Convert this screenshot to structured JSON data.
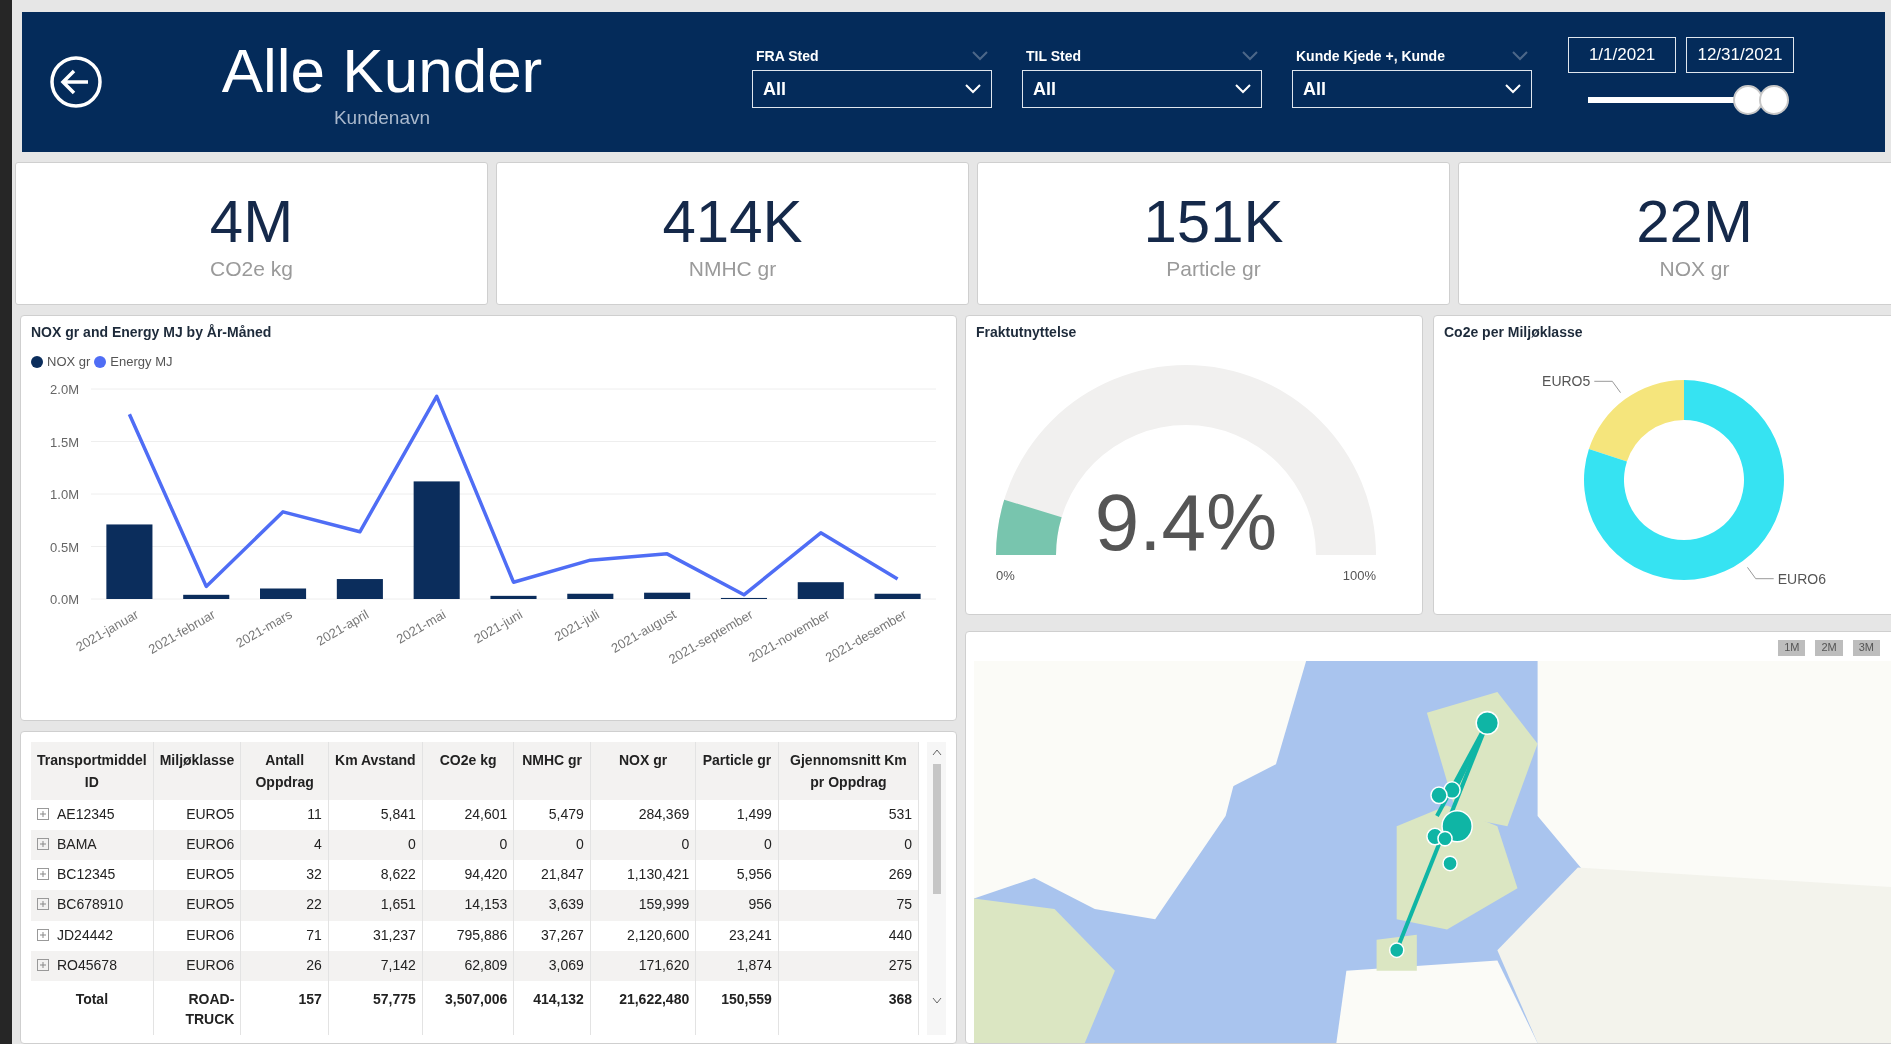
{
  "header": {
    "title": "Alle Kunder",
    "subtitle": "Kundenavn",
    "filters": [
      {
        "label": "FRA Sted",
        "value": "All"
      },
      {
        "label": "TIL Sted",
        "value": "All"
      },
      {
        "label": "Kunde Kjede +, Kunde",
        "value": "All"
      }
    ],
    "date_from": "1/1/2021",
    "date_to": "12/31/2021",
    "date_slider": {
      "thumbs": [
        {
          "level": 0.8
        },
        {
          "level": 0.93
        }
      ]
    }
  },
  "kpis": [
    {
      "value": "4M",
      "label": "CO2e kg"
    },
    {
      "value": "414K",
      "label": "NMHC gr"
    },
    {
      "value": "151K",
      "label": "Particle gr"
    },
    {
      "value": "22M",
      "label": "NOX gr"
    }
  ],
  "combo_chart": {
    "chart_data": {
      "type": "bar",
      "title": "NOX gr and Energy MJ by År-Måned",
      "categories": [
        "2021-januar",
        "2021-februar",
        "2021-mars",
        "2021-april",
        "2021-mai",
        "2021-juni",
        "2021-juli",
        "2021-august",
        "2021-september",
        "2021-november",
        "2021-desember"
      ],
      "series": [
        {
          "name": "NOX gr",
          "color": "#0b2d5c",
          "type": "bar",
          "values": [
            710000,
            40000,
            100000,
            190000,
            1120000,
            30000,
            50000,
            60000,
            10000,
            160000,
            50000
          ]
        },
        {
          "name": "Energy MJ",
          "color": "#4f6df5",
          "type": "line",
          "values": [
            1760000,
            120000,
            830000,
            640000,
            1930000,
            160000,
            370000,
            430000,
            40000,
            630000,
            190000
          ]
        }
      ],
      "ylim": [
        0,
        2000000
      ],
      "grid": true,
      "yticks": [
        {
          "value": 0,
          "label": "0.0M"
        },
        {
          "value": 500000,
          "label": "0.5M"
        },
        {
          "value": 1000000,
          "label": "1.0M"
        },
        {
          "value": 1500000,
          "label": "1.5M"
        },
        {
          "value": 2000000,
          "label": "2.0M"
        }
      ]
    }
  },
  "gauge": {
    "title": "Fraktutnyttelse",
    "level": 0.094,
    "reading": "9.4%",
    "min": "0%",
    "max": "100%"
  },
  "donut": {
    "title": "Co2e per Miljøklasse",
    "slices": [
      {
        "label": "EURO5",
        "color": "#f5e57c"
      },
      {
        "label": "EURO6",
        "color": "#36e3f2"
      }
    ]
  },
  "table": {
    "columns": [
      "Transportmiddel ID",
      "Miljøklasse",
      "Antall Oppdrag",
      "Km Avstand",
      "CO2e kg",
      "NMHC gr",
      "NOX gr",
      "Particle gr",
      "Gjennomsnitt Km pr Oppdrag"
    ],
    "rows": [
      [
        "AE12345",
        "EURO5",
        "11",
        "5,841",
        "24,601",
        "5,479",
        "284,369",
        "1,499",
        "531"
      ],
      [
        "BAMA",
        "EURO6",
        "4",
        "0",
        "0",
        "0",
        "0",
        "0",
        "0"
      ],
      [
        "BC12345",
        "EURO5",
        "32",
        "8,622",
        "94,420",
        "21,847",
        "1,130,421",
        "5,956",
        "269"
      ],
      [
        "BC678910",
        "EURO5",
        "22",
        "1,651",
        "14,153",
        "3,639",
        "159,999",
        "956",
        "75"
      ],
      [
        "JD24442",
        "EURO6",
        "71",
        "31,237",
        "795,886",
        "37,267",
        "2,120,600",
        "23,241",
        "440"
      ],
      [
        "RO45678",
        "EURO6",
        "26",
        "7,142",
        "62,809",
        "3,069",
        "171,620",
        "1,874",
        "275"
      ]
    ],
    "total": [
      "Total",
      "ROAD-TRUCK",
      "157",
      "57,775",
      "3,507,006",
      "414,132",
      "21,622,480",
      "150,559",
      "368"
    ]
  },
  "map": {
    "scale_labels": [
      "1M",
      "2M",
      "3M"
    ]
  }
}
